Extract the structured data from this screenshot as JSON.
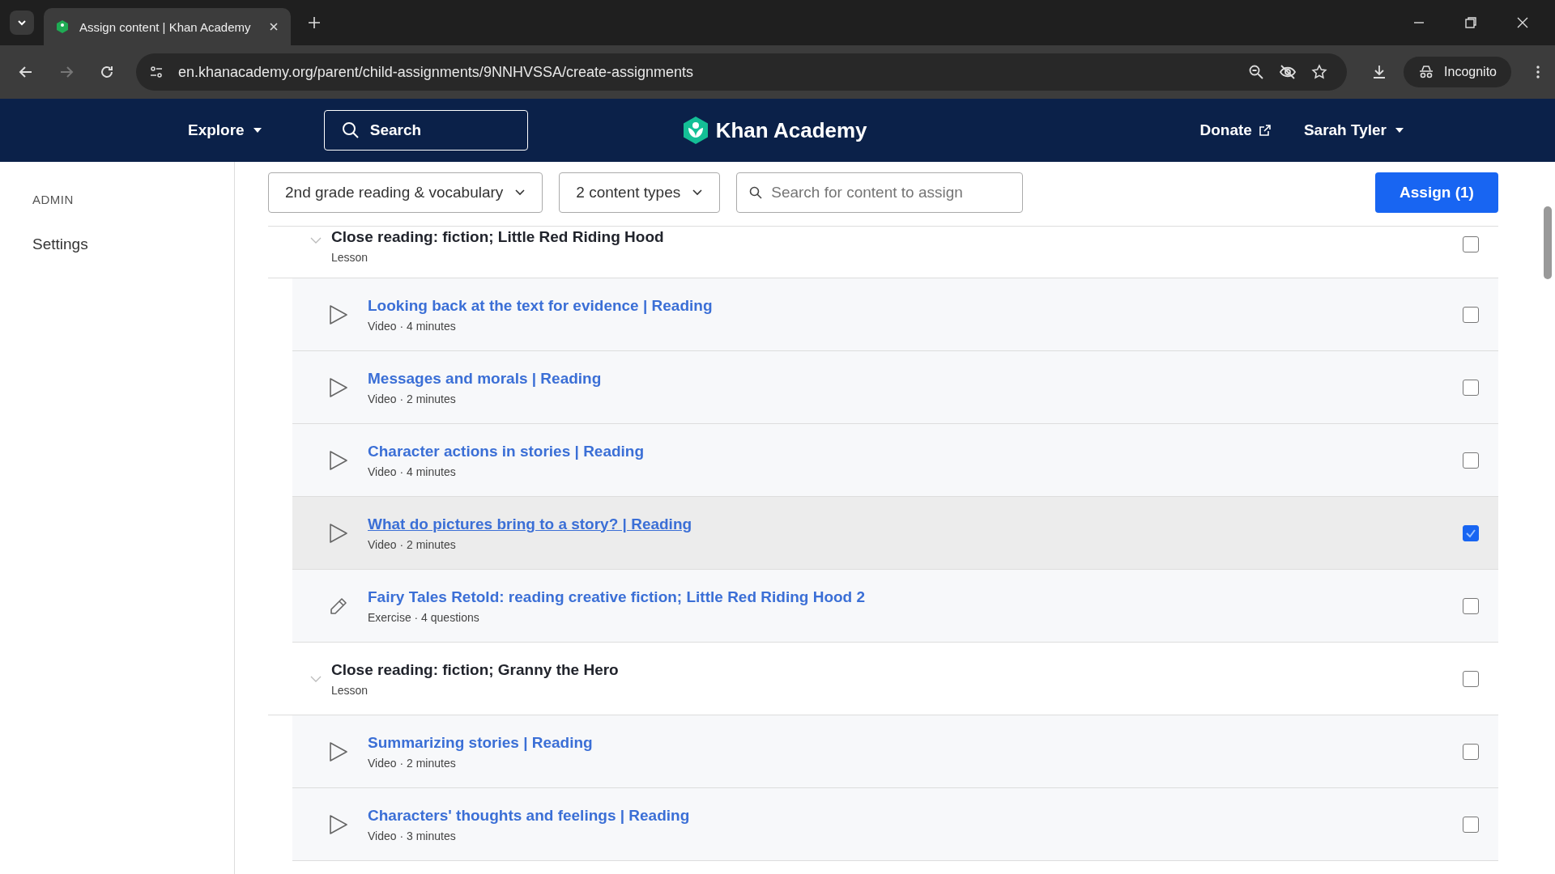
{
  "browser": {
    "tab_title": "Assign content | Khan Academy",
    "url": "en.khanacademy.org/parent/child-assignments/9NNHVSSA/create-assignments",
    "incognito_label": "Incognito"
  },
  "header": {
    "explore": "Explore",
    "search": "Search",
    "logo": "Khan Academy",
    "donate": "Donate",
    "user": "Sarah Tyler"
  },
  "sidebar": {
    "heading": "ADMIN",
    "items": [
      {
        "label": "Settings"
      }
    ]
  },
  "filters": {
    "course": "2nd grade reading & vocabulary",
    "content_types": "2 content types",
    "search_placeholder": "Search for content to assign",
    "assign_button": "Assign (1)"
  },
  "items": [
    {
      "kind": "lesson",
      "title": "Close reading: fiction; Little Red Riding Hood",
      "meta": "Lesson",
      "checked": false
    },
    {
      "kind": "video",
      "title": "Looking back at the text for evidence | Reading",
      "meta": "Video · 4 minutes",
      "checked": false
    },
    {
      "kind": "video",
      "title": "Messages and morals | Reading",
      "meta": "Video · 2 minutes",
      "checked": false
    },
    {
      "kind": "video",
      "title": "Character actions in stories | Reading",
      "meta": "Video · 4 minutes",
      "checked": false
    },
    {
      "kind": "video",
      "title": "What do pictures bring to a story? | Reading",
      "meta": "Video · 2 minutes",
      "checked": true
    },
    {
      "kind": "exercise",
      "title": "Fairy Tales Retold: reading creative fiction; Little Red Riding Hood 2",
      "meta": "Exercise · 4 questions",
      "checked": false
    },
    {
      "kind": "lesson",
      "title": "Close reading: fiction; Granny the Hero",
      "meta": "Lesson",
      "checked": false
    },
    {
      "kind": "video",
      "title": "Summarizing stories | Reading",
      "meta": "Video · 2 minutes",
      "checked": false
    },
    {
      "kind": "video",
      "title": "Characters' thoughts and feelings | Reading",
      "meta": "Video · 3 minutes",
      "checked": false
    }
  ]
}
